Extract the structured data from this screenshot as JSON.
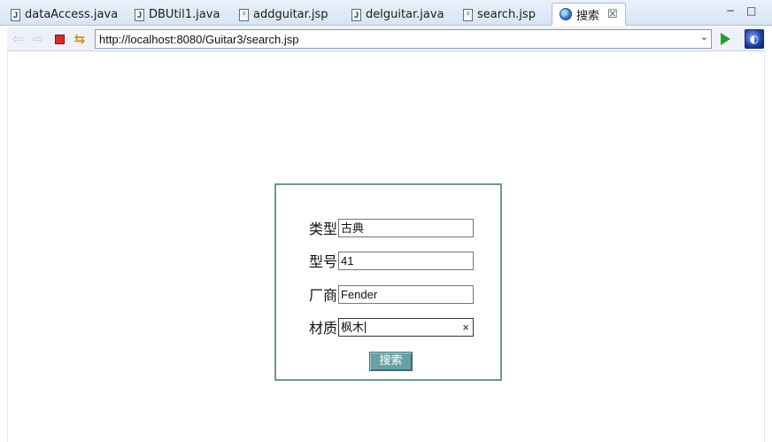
{
  "tabs": [
    {
      "label": "dataAccess.java",
      "icon": "java-file-icon"
    },
    {
      "label": "DBUtil1.java",
      "icon": "java-file-icon"
    },
    {
      "label": "addguitar.jsp",
      "icon": "jsp-file-icon"
    },
    {
      "label": "delguitar.java",
      "icon": "java-file-icon"
    },
    {
      "label": "search.jsp",
      "icon": "jsp-file-icon"
    },
    {
      "label": "搜索",
      "icon": "globe-icon",
      "active": true
    }
  ],
  "file_icon_glyphs": {
    "java": "J",
    "jsp": "≡"
  },
  "window_controls": {
    "minimize": "−",
    "maximize": "□"
  },
  "nav": {
    "back": "⇦",
    "forward": "⇨",
    "refresh": "⇆",
    "url": "http://localhost:8080/Guitar3/search.jsp",
    "dropdown": "⌄"
  },
  "form": {
    "fields": [
      {
        "label": "类型",
        "value": "古典"
      },
      {
        "label": "型号",
        "value": "41"
      },
      {
        "label": "厂商",
        "value": "Fender"
      },
      {
        "label": "材质",
        "value": "枫木",
        "focused": true
      }
    ],
    "clear_glyph": "×",
    "submit_label": "搜索"
  },
  "colors": {
    "form_border": "#6a9a95",
    "button_bg": "#6aa0a0",
    "stop_red": "#d42a2a",
    "go_green": "#23a02e"
  }
}
